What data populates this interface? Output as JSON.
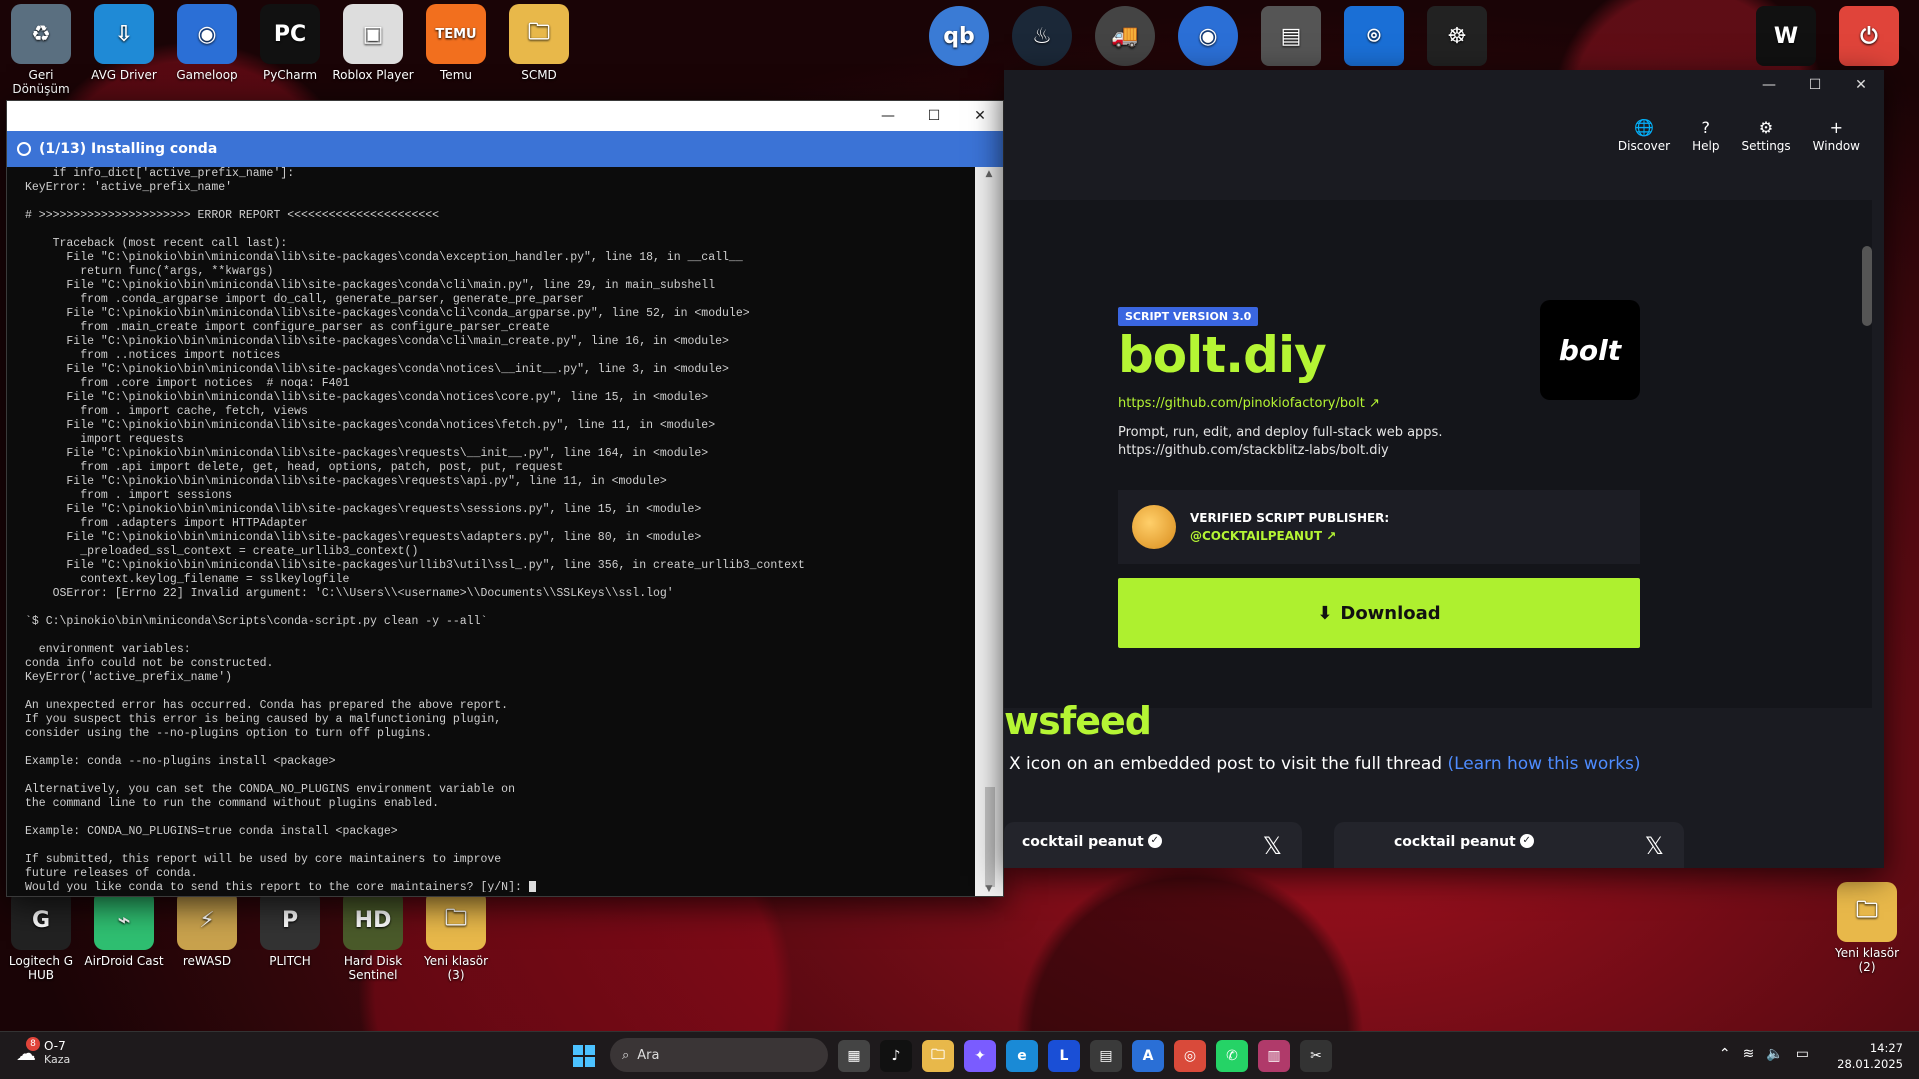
{
  "desktop": {
    "top_icons": [
      {
        "label": "Geri Dönüşüm",
        "glyph": "♻",
        "color": "#5a6f80"
      },
      {
        "label": "AVG Driver",
        "glyph": "⇩",
        "color": "#1f8ad6"
      },
      {
        "label": "Gameloop",
        "glyph": "◉",
        "color": "#2b6fd6"
      },
      {
        "label": "PyCharm",
        "glyph": "PC",
        "color": "#111111"
      },
      {
        "label": "Roblox Player",
        "glyph": "▣",
        "color": "#dddddd"
      },
      {
        "label": "Temu",
        "glyph": "TEMU",
        "color": "#f26f1e"
      },
      {
        "label": "SCMD",
        "glyph": "🗀",
        "color": "#e8b84a"
      }
    ],
    "top_right_icons": [
      {
        "name": "qbittorrent-icon",
        "glyph": "qb",
        "color": "#3a7bd5"
      },
      {
        "name": "steam-icon",
        "glyph": "♨",
        "color": "#1b2838"
      },
      {
        "name": "truck-simulator-icon",
        "glyph": "🚚",
        "color": "#444444"
      },
      {
        "name": "gameloop-icon",
        "glyph": "◉",
        "color": "#2b6fd6"
      },
      {
        "name": "virtual-machine-icon",
        "glyph": "▤",
        "color": "#555555"
      },
      {
        "name": "screenshot-tool-icon",
        "glyph": "⌾",
        "color": "#1a6fd6"
      },
      {
        "name": "octopus-icon",
        "glyph": "☸",
        "color": "#222222"
      },
      {
        "name": "w-logo-icon",
        "glyph": "W",
        "color": "#111111"
      },
      {
        "name": "power-app-icon",
        "glyph": "⏻",
        "color": "#e0443a"
      }
    ],
    "bottom_icons": [
      {
        "label": "Logitech G HUB",
        "glyph": "G",
        "color": "#222222"
      },
      {
        "label": "AirDroid Cast",
        "glyph": "⌁",
        "color": "#2fbf71"
      },
      {
        "label": "reWASD",
        "glyph": "⚡",
        "color": "#c9a24d"
      },
      {
        "label": "PLITCH",
        "glyph": "P",
        "color": "#333333"
      },
      {
        "label": "Hard Disk Sentinel",
        "glyph": "HD",
        "color": "#4a5a2a"
      },
      {
        "label": "Yeni klasör (3)",
        "glyph": "🗀",
        "color": "#e8b84a"
      }
    ],
    "right_icons": [
      {
        "label": "Yeni klasör (2)",
        "glyph": "🗀",
        "color": "#e8b84a"
      }
    ]
  },
  "terminal": {
    "status": "(1/13) Installing conda",
    "lines": [
      "    if info_dict['active_prefix_name']:",
      "KeyError: 'active_prefix_name'",
      "",
      "# >>>>>>>>>>>>>>>>>>>>>> ERROR REPORT <<<<<<<<<<<<<<<<<<<<<<",
      "",
      "    Traceback (most recent call last):",
      "      File \"C:\\pinokio\\bin\\miniconda\\lib\\site-packages\\conda\\exception_handler.py\", line 18, in __call__",
      "        return func(*args, **kwargs)",
      "      File \"C:\\pinokio\\bin\\miniconda\\lib\\site-packages\\conda\\cli\\main.py\", line 29, in main_subshell",
      "        from .conda_argparse import do_call, generate_parser, generate_pre_parser",
      "      File \"C:\\pinokio\\bin\\miniconda\\lib\\site-packages\\conda\\cli\\conda_argparse.py\", line 52, in <module>",
      "        from .main_create import configure_parser as configure_parser_create",
      "      File \"C:\\pinokio\\bin\\miniconda\\lib\\site-packages\\conda\\cli\\main_create.py\", line 16, in <module>",
      "        from ..notices import notices",
      "      File \"C:\\pinokio\\bin\\miniconda\\lib\\site-packages\\conda\\notices\\__init__.py\", line 3, in <module>",
      "        from .core import notices  # noqa: F401",
      "      File \"C:\\pinokio\\bin\\miniconda\\lib\\site-packages\\conda\\notices\\core.py\", line 15, in <module>",
      "        from . import cache, fetch, views",
      "      File \"C:\\pinokio\\bin\\miniconda\\lib\\site-packages\\conda\\notices\\fetch.py\", line 11, in <module>",
      "        import requests",
      "      File \"C:\\pinokio\\bin\\miniconda\\lib\\site-packages\\requests\\__init__.py\", line 164, in <module>",
      "        from .api import delete, get, head, options, patch, post, put, request",
      "      File \"C:\\pinokio\\bin\\miniconda\\lib\\site-packages\\requests\\api.py\", line 11, in <module>",
      "        from . import sessions",
      "      File \"C:\\pinokio\\bin\\miniconda\\lib\\site-packages\\requests\\sessions.py\", line 15, in <module>",
      "        from .adapters import HTTPAdapter",
      "      File \"C:\\pinokio\\bin\\miniconda\\lib\\site-packages\\requests\\adapters.py\", line 80, in <module>",
      "        _preloaded_ssl_context = create_urllib3_context()",
      "      File \"C:\\pinokio\\bin\\miniconda\\lib\\site-packages\\urllib3\\util\\ssl_.py\", line 356, in create_urllib3_context",
      "        context.keylog_filename = sslkeylogfile",
      "    OSError: [Errno 22] Invalid argument: 'C:\\\\Users\\\\<username>\\\\Documents\\\\SSLKeys\\\\ssl.log'",
      "",
      "`$ C:\\pinokio\\bin\\miniconda\\Scripts\\conda-script.py clean -y --all`",
      "",
      "  environment variables:",
      "conda info could not be constructed.",
      "KeyError('active_prefix_name')",
      "",
      "An unexpected error has occurred. Conda has prepared the above report.",
      "If you suspect this error is being caused by a malfunctioning plugin,",
      "consider using the --no-plugins option to turn off plugins.",
      "",
      "Example: conda --no-plugins install <package>",
      "",
      "Alternatively, you can set the CONDA_NO_PLUGINS environment variable on",
      "the command line to run the command without plugins enabled.",
      "",
      "Example: CONDA_NO_PLUGINS=true conda install <package>",
      "",
      "If submitted, this report will be used by core maintainers to improve",
      "future releases of conda.",
      "Would you like conda to send this report to the core maintainers? [y/N]: "
    ]
  },
  "pinokio": {
    "nav": [
      {
        "label": "Discover",
        "glyph": "🌐",
        "icon": "globe-icon"
      },
      {
        "label": "Help",
        "glyph": "?",
        "icon": "question-icon"
      },
      {
        "label": "Settings",
        "glyph": "⚙",
        "icon": "gear-icon"
      },
      {
        "label": "Window",
        "glyph": "+",
        "icon": "plus-icon"
      }
    ],
    "badge": "SCRIPT VERSION 3.0",
    "title": "bolt.diy",
    "repo_link": "https://github.com/pinokiofactory/bolt",
    "description_line1": "Prompt, run, edit, and deploy full-stack web apps.",
    "description_line2": "https://github.com/stackblitz-labs/bolt.diy",
    "logo_text": "bolt",
    "publisher_label": "VERIFIED SCRIPT PUBLISHER:",
    "publisher_handle": "@COCKTAILPEANUT",
    "download_label": "Download",
    "newsfeed_title": "wsfeed",
    "newsfeed_sub": "X icon on an embedded post to visit the full thread",
    "newsfeed_link": "(Learn how this works)",
    "cards": [
      {
        "author": "cocktail peanut"
      },
      {
        "author": "cocktail peanut"
      }
    ]
  },
  "taskbar": {
    "weather_temp": "O-7",
    "weather_cond": "Kaza",
    "weather_badge": "8",
    "search_placeholder": "Ara",
    "apps": [
      {
        "name": "task-view-icon",
        "glyph": "▦",
        "color": "#444444"
      },
      {
        "name": "tiktok-icon",
        "glyph": "♪",
        "color": "#111111"
      },
      {
        "name": "file-explorer-icon",
        "glyph": "🗀",
        "color": "#e8b84a"
      },
      {
        "name": "copilot-icon",
        "glyph": "✦",
        "color": "#7a5cff"
      },
      {
        "name": "edge-icon",
        "glyph": "e",
        "color": "#1a8ad6"
      },
      {
        "name": "l-app-icon",
        "glyph": "L",
        "color": "#1a4fd6"
      },
      {
        "name": "store-icon",
        "glyph": "▤",
        "color": "#3a3a3a"
      },
      {
        "name": "writer-icon",
        "glyph": "A",
        "color": "#2a6fd6"
      },
      {
        "name": "chrome-icon",
        "glyph": "◎",
        "color": "#d94a3a"
      },
      {
        "name": "whatsapp-icon",
        "glyph": "✆",
        "color": "#25d366"
      },
      {
        "name": "winrar-icon",
        "glyph": "▥",
        "color": "#b03a6a"
      },
      {
        "name": "snipping-tool-icon",
        "glyph": "✂",
        "color": "#333333"
      }
    ],
    "time": "14:27",
    "date": "28.01.2025"
  }
}
